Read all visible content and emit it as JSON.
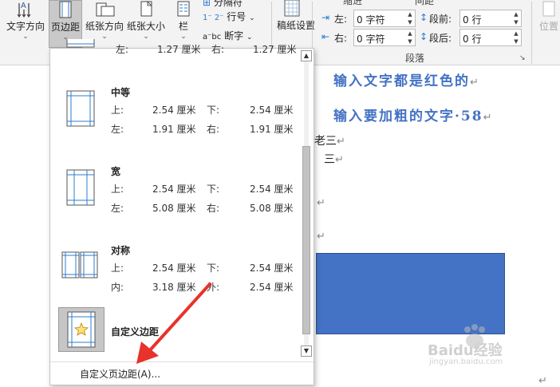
{
  "ribbon": {
    "buttons": [
      {
        "label": "文字方向",
        "icon": "text-direction-icon"
      },
      {
        "label": "页边距",
        "icon": "margins-icon"
      },
      {
        "label": "纸张方向",
        "icon": "orientation-icon"
      },
      {
        "label": "纸张大小",
        "icon": "page-size-icon"
      },
      {
        "label": "栏",
        "icon": "columns-icon"
      },
      {
        "label": "稿纸设置",
        "icon": "manuscript-icon"
      }
    ],
    "small_buttons": {
      "breaks": "分隔符",
      "line_numbers": "行号",
      "hyphenation": "断字"
    },
    "indent_header": "缩进",
    "spacing_header": "间距",
    "indent": {
      "left_label": "左:",
      "left_value": "0 字符",
      "right_label": "右:",
      "right_value": "0 字符"
    },
    "spacing": {
      "before_label": "段前:",
      "before_value": "0 行",
      "after_label": "段后:",
      "after_value": "0 行"
    },
    "group_label": "段落",
    "position_label": "位置"
  },
  "document": {
    "line1": "输入文字都是红色的",
    "line2": "输入要加粗的文字·58",
    "fragment1": "老三",
    "fragment2": "三",
    "paragraph_mark": "↵",
    "shape_color": "#4472c4"
  },
  "dropdown": {
    "items": [
      {
        "title": "中等",
        "row1": [
          "上:",
          "2.54 厘米",
          "下:",
          "2.54 厘米"
        ],
        "row2": [
          "左:",
          "1.91 厘米",
          "右:",
          "1.91 厘米"
        ]
      },
      {
        "title": "宽",
        "row1": [
          "上:",
          "2.54 厘米",
          "下:",
          "2.54 厘米"
        ],
        "row2": [
          "左:",
          "5.08 厘米",
          "右:",
          "5.08 厘米"
        ]
      },
      {
        "title": "对称",
        "row1": [
          "上:",
          "2.54 厘米",
          "下:",
          "2.54 厘米"
        ],
        "row2": [
          "内:",
          "3.18 厘米",
          "外:",
          "2.54 厘米"
        ]
      }
    ],
    "partial_row": [
      "左:",
      "1.27 厘米",
      "右:",
      "1.27 厘米"
    ],
    "custom_item_title": "自定义边距",
    "custom_margins_link": "自定义页边距(A)..."
  },
  "watermark": {
    "brand": "Baidu经验",
    "url": "jingyan.baidu.com"
  },
  "colors": {
    "accent": "#4472c4",
    "arrow": "#e8322b"
  }
}
